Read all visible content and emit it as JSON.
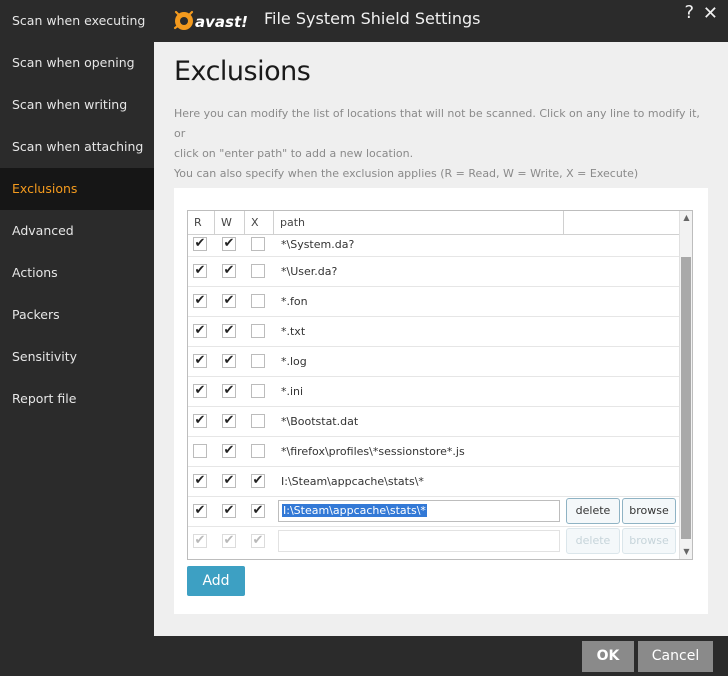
{
  "window": {
    "title": "File System Shield Settings",
    "help_glyph": "?",
    "close_glyph": "✕",
    "logo_text": "avast!",
    "logo_color": "#f39a1e"
  },
  "sidebar": {
    "items": [
      {
        "label": "Scan when executing"
      },
      {
        "label": "Scan when opening"
      },
      {
        "label": "Scan when writing"
      },
      {
        "label": "Scan when attaching"
      },
      {
        "label": "Exclusions",
        "active": true
      },
      {
        "label": "Advanced"
      },
      {
        "label": "Actions"
      },
      {
        "label": "Packers"
      },
      {
        "label": "Sensitivity"
      },
      {
        "label": "Report file"
      }
    ],
    "active_color": "#f39a1e"
  },
  "main": {
    "title": "Exclusions",
    "description_lines": [
      "Here you can modify the list of locations that will not be scanned. Click on any line to modify it, or",
      "click on \"enter path\" to add a new location.",
      "You can also specify when the exclusion applies (R = Read, W = Write, X = Execute)"
    ]
  },
  "table": {
    "headers": {
      "r": "R",
      "w": "W",
      "x": "X",
      "path": "path"
    },
    "rows": [
      {
        "r": true,
        "w": true,
        "x": false,
        "path": "*\\System.da?"
      },
      {
        "r": true,
        "w": true,
        "x": false,
        "path": "*\\User.da?"
      },
      {
        "r": true,
        "w": true,
        "x": false,
        "path": "*.fon"
      },
      {
        "r": true,
        "w": true,
        "x": false,
        "path": "*.txt"
      },
      {
        "r": true,
        "w": true,
        "x": false,
        "path": "*.log"
      },
      {
        "r": true,
        "w": true,
        "x": false,
        "path": "*.ini"
      },
      {
        "r": true,
        "w": true,
        "x": false,
        "path": "*\\Bootstat.dat"
      },
      {
        "r": false,
        "w": true,
        "x": false,
        "path": "*\\firefox\\profiles\\*sessionstore*.js"
      },
      {
        "r": true,
        "w": true,
        "x": true,
        "path": "I:\\Steam\\appcache\\stats\\*"
      }
    ],
    "editing_row": {
      "r": true,
      "w": true,
      "x": true,
      "value": "I:\\Steam\\appcache\\stats\\*"
    },
    "delete_label": "delete",
    "browse_label": "browse",
    "checkmark": "✔"
  },
  "add_label": "Add",
  "footer": {
    "ok_label": "OK",
    "cancel_label": "Cancel"
  },
  "accent_add": "#3da0c3",
  "selection_color": "#3379d6"
}
